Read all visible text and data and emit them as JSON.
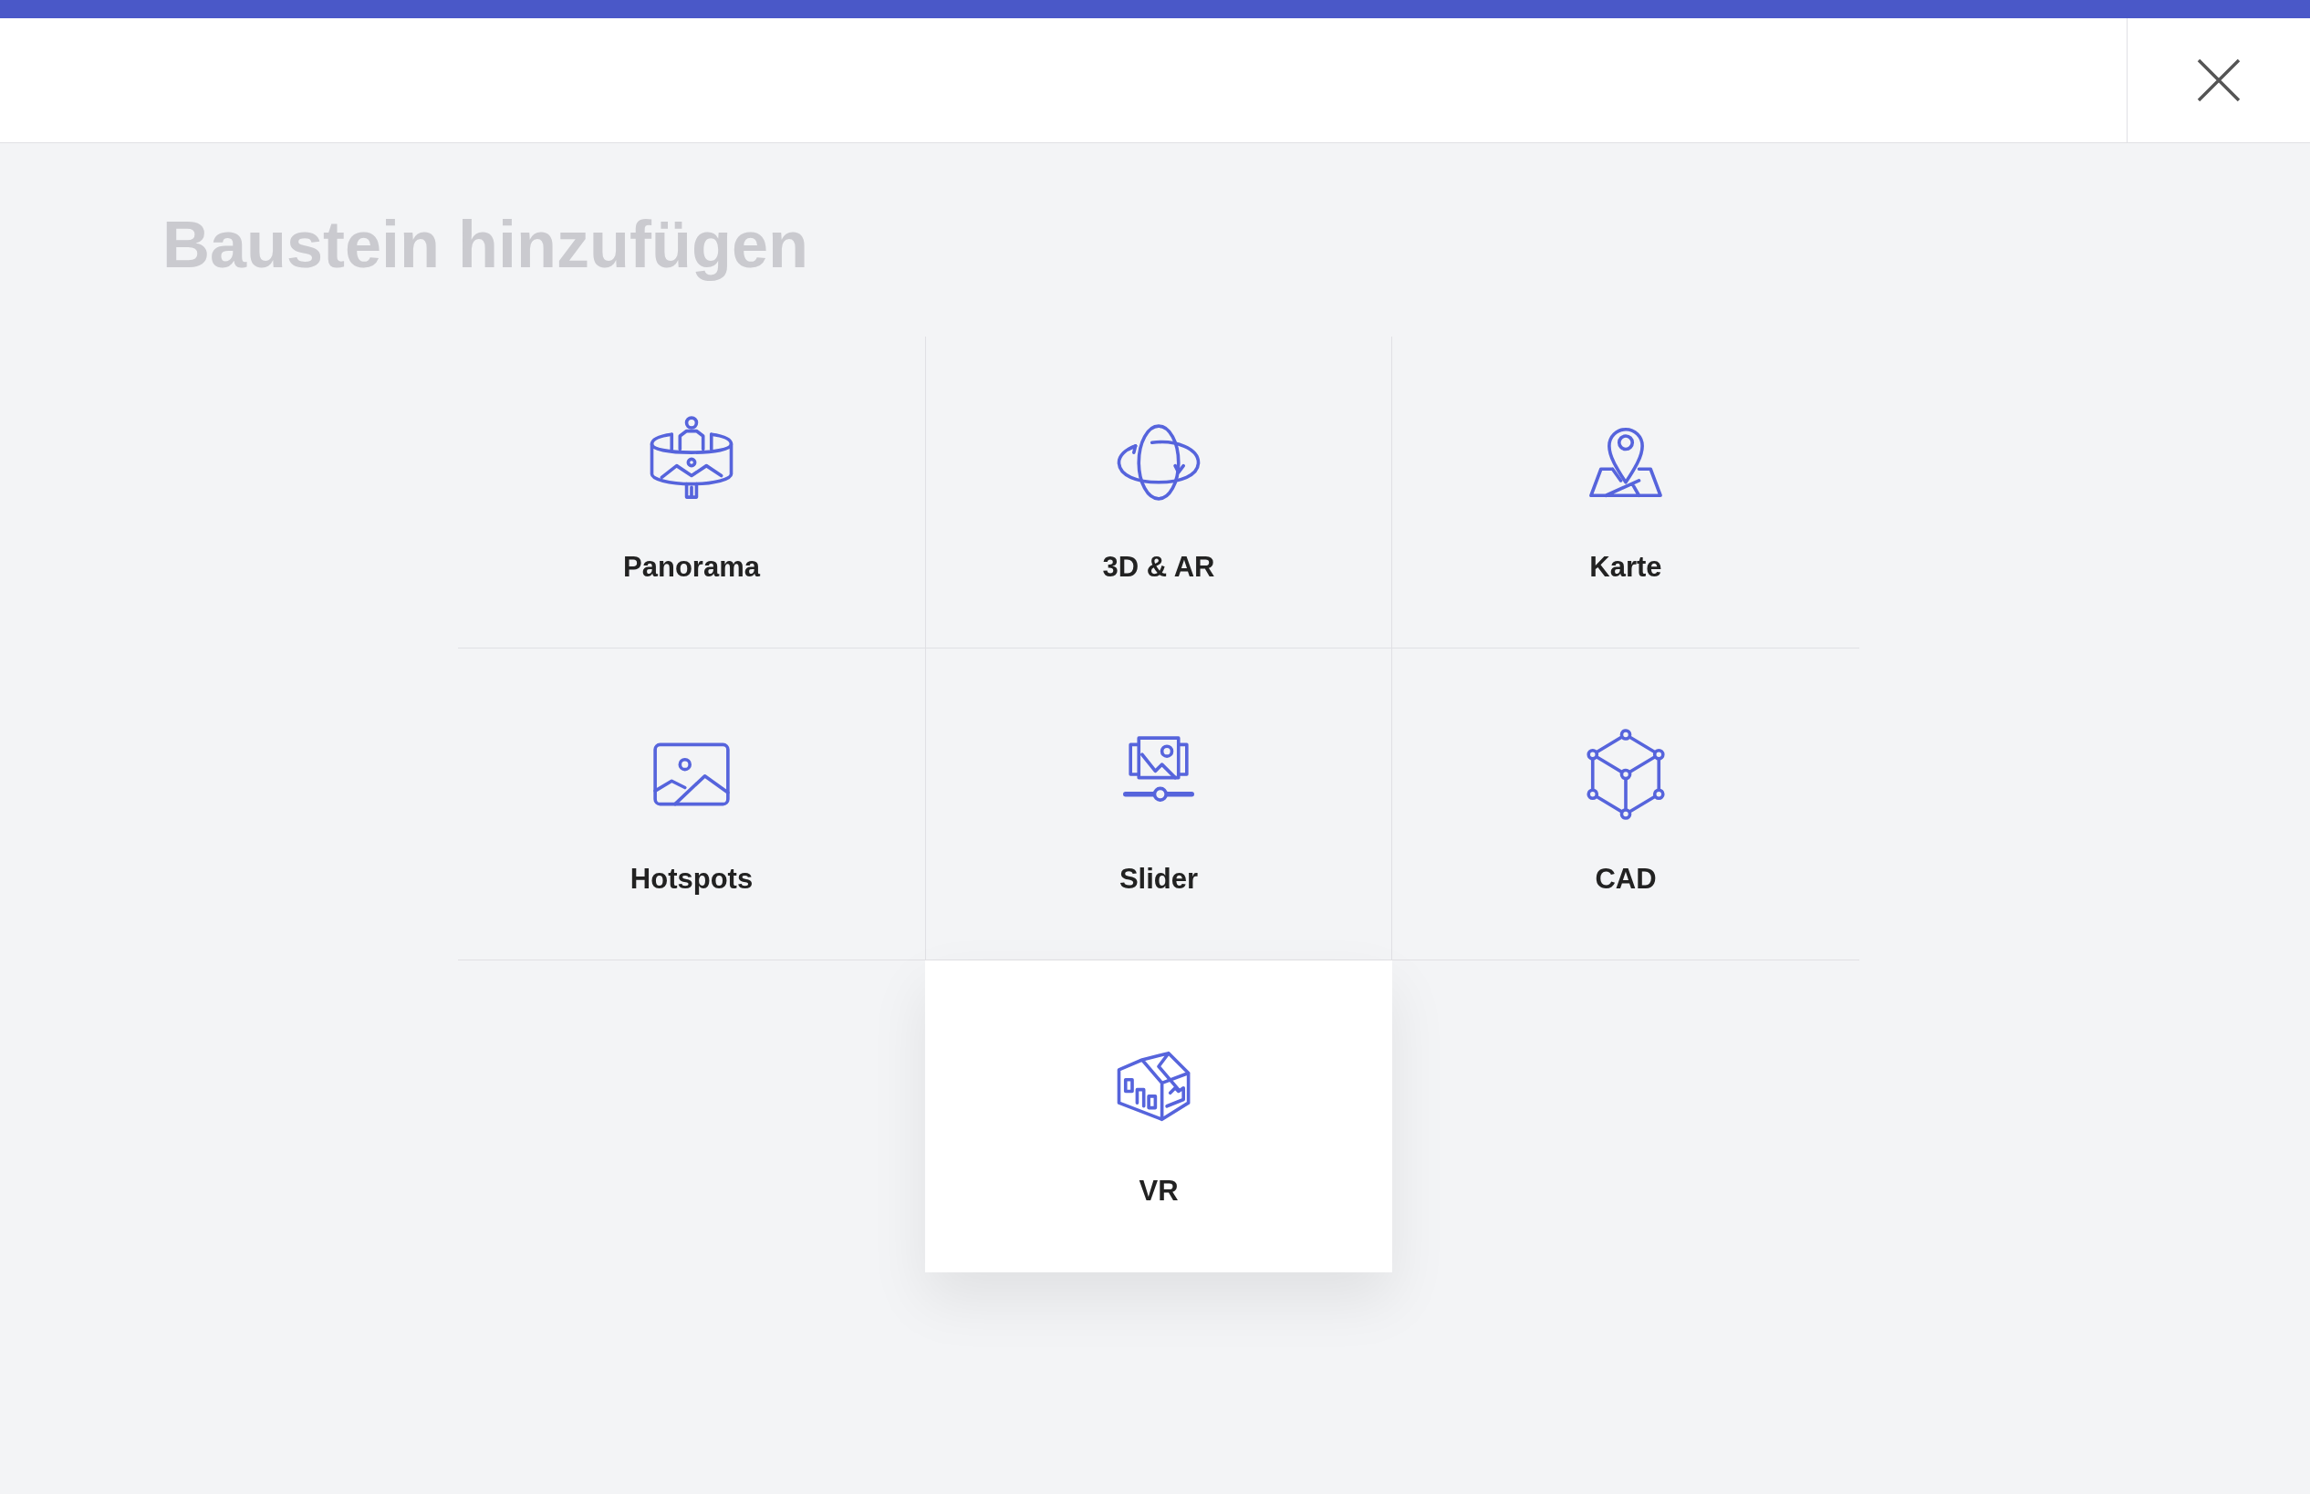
{
  "title": "Baustein hinzufügen",
  "blocks": [
    {
      "label": "Panorama",
      "kind": "panorama",
      "selected": false
    },
    {
      "label": "3D & AR",
      "kind": "orbit",
      "selected": false
    },
    {
      "label": "Karte",
      "kind": "map",
      "selected": false
    },
    {
      "label": "Hotspots",
      "kind": "image",
      "selected": false
    },
    {
      "label": "Slider",
      "kind": "slider",
      "selected": false
    },
    {
      "label": "CAD",
      "kind": "cube",
      "selected": false
    },
    {
      "label": "VR",
      "kind": "house",
      "selected": true
    }
  ]
}
